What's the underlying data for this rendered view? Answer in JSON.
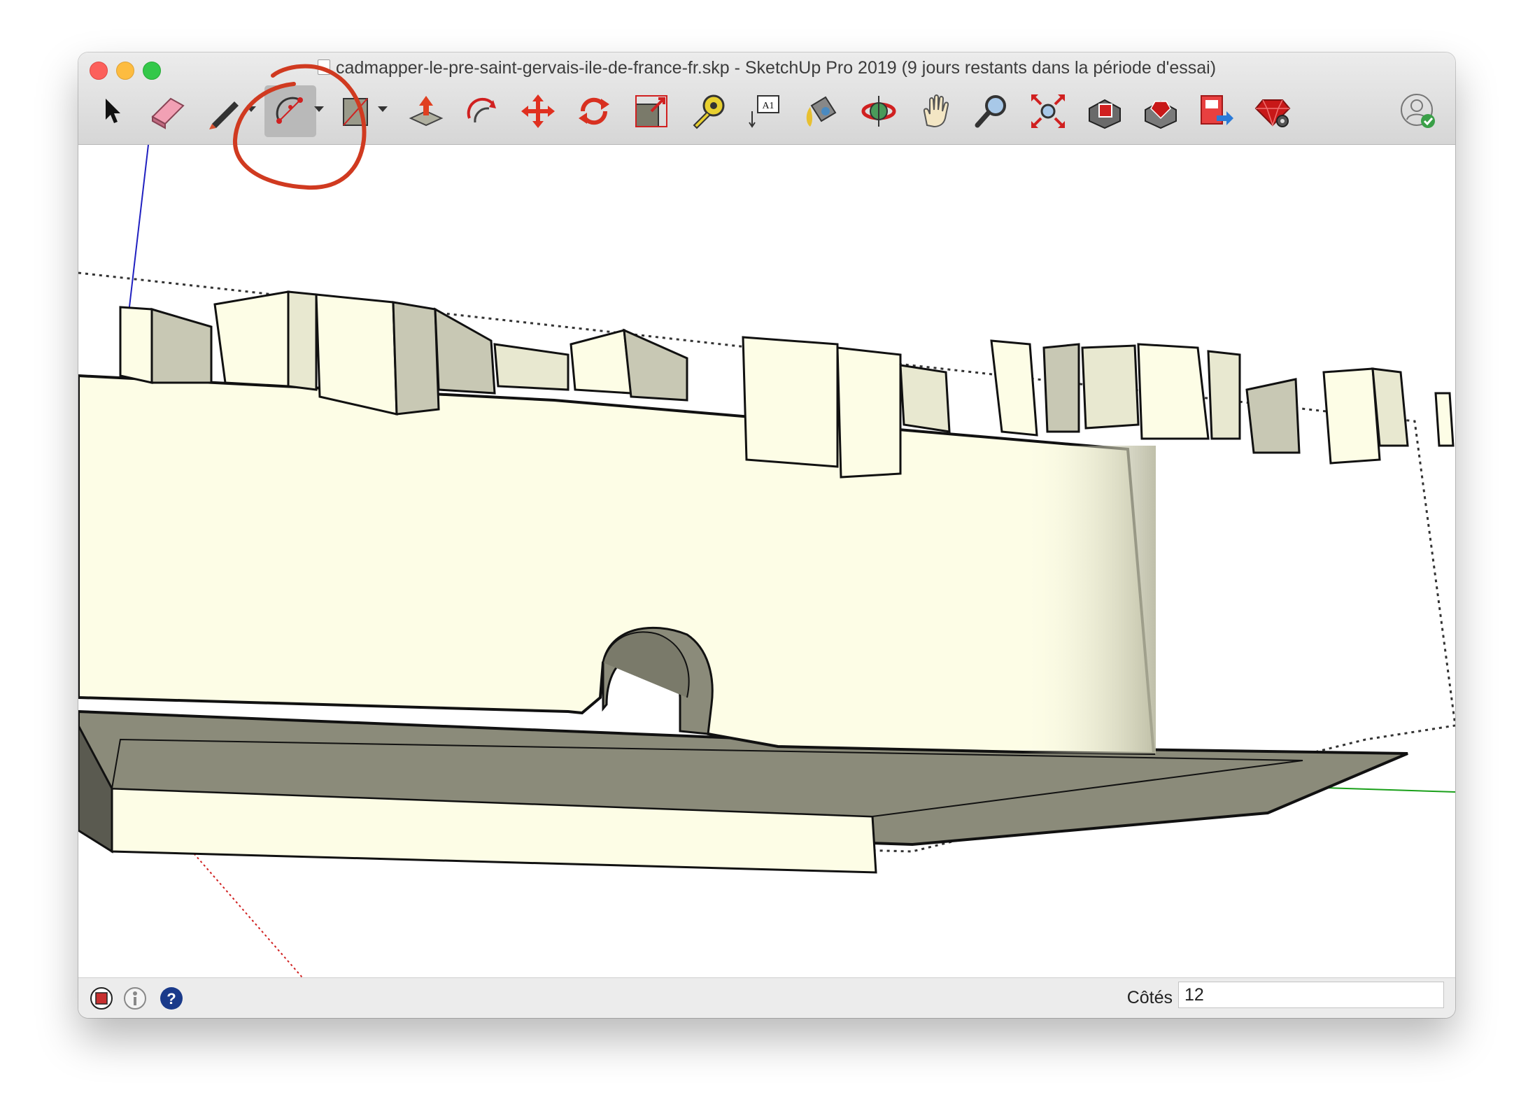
{
  "window": {
    "title": "cadmapper-le-pre-saint-gervais-ile-de-france-fr.skp - SketchUp Pro 2019 (9 jours restants dans la période d'essai)"
  },
  "toolbar": {
    "tools": [
      {
        "name": "select-tool",
        "icon": "arrow-cursor-icon"
      },
      {
        "name": "eraser-tool",
        "icon": "eraser-icon"
      },
      {
        "name": "line-tool",
        "icon": "pencil-icon"
      },
      {
        "name": "arc-tool",
        "icon": "arc-icon",
        "active": true
      },
      {
        "name": "rectangle-tool",
        "icon": "rectangle-icon"
      },
      {
        "name": "push-pull-tool",
        "icon": "push-pull-icon"
      },
      {
        "name": "offset-tool",
        "icon": "offset-icon"
      },
      {
        "name": "move-tool",
        "icon": "move-icon"
      },
      {
        "name": "rotate-tool",
        "icon": "rotate-icon"
      },
      {
        "name": "scale-tool",
        "icon": "scale-icon"
      },
      {
        "name": "tape-measure-tool",
        "icon": "tape-measure-icon"
      },
      {
        "name": "text-tool",
        "icon": "text-label-icon",
        "label": "A1"
      },
      {
        "name": "paint-bucket-tool",
        "icon": "paint-bucket-icon"
      },
      {
        "name": "orbit-tool",
        "icon": "orbit-icon"
      },
      {
        "name": "pan-tool",
        "icon": "hand-icon"
      },
      {
        "name": "zoom-tool",
        "icon": "magnifier-icon"
      },
      {
        "name": "zoom-extents-tool",
        "icon": "zoom-extents-icon"
      },
      {
        "name": "3d-warehouse-button",
        "icon": "warehouse-icon"
      },
      {
        "name": "extension-warehouse-button",
        "icon": "extension-warehouse-icon"
      },
      {
        "name": "send-to-layout-button",
        "icon": "layout-icon"
      },
      {
        "name": "extension-manager-button",
        "icon": "ruby-gear-icon"
      },
      {
        "name": "account-button",
        "icon": "user-account-icon"
      }
    ]
  },
  "statusbar": {
    "vcb_label": "Côtés",
    "vcb_value": "12"
  },
  "colors": {
    "face_front": "#fdfde6",
    "face_back": "#8b8b7a",
    "axis_red": "#d02020",
    "axis_green": "#1aa01a",
    "axis_blue": "#2020c0",
    "annotation": "#d03a20"
  }
}
